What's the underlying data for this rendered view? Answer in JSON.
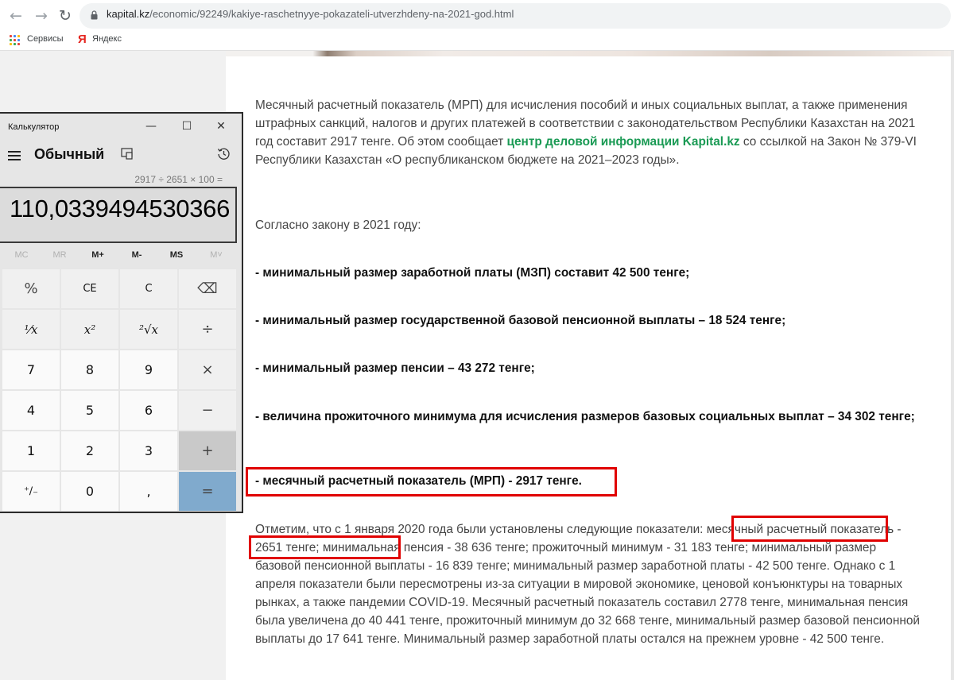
{
  "browser": {
    "url_host": "kapital.kz",
    "url_path": "/economic/92249/kakiye-raschetnyye-pokazateli-utverzhdeny-na-2021-god.html",
    "bookmarks": [
      "Сервисы",
      "Яндекс"
    ]
  },
  "calculator": {
    "title": "Калькулятор",
    "mode": "Обычный",
    "expression": "2917 ÷ 2651 × 100 =",
    "display": "110,0339494530366",
    "memory": [
      "MC",
      "MR",
      "M+",
      "M-",
      "MS",
      "M˅"
    ],
    "memory_enabled": [
      false,
      false,
      true,
      true,
      true,
      false
    ],
    "keys": [
      [
        "%",
        "CE",
        "C",
        "⌫"
      ],
      [
        "⅟x",
        "x²",
        "²√x",
        "÷"
      ],
      [
        "7",
        "8",
        "9",
        "×"
      ],
      [
        "4",
        "5",
        "6",
        "−"
      ],
      [
        "1",
        "2",
        "3",
        "+"
      ],
      [
        "⁺∕₋",
        "0",
        ",",
        "="
      ]
    ],
    "accent_equals": "#80aacd"
  },
  "article": {
    "intro_a": "Месячный расчетный показатель (МРП) для исчисления пособий и иных социальных выплат, а также применения штрафных санкций, налогов и других платежей в соответствии с законодательством Республики Казахстан на 2021 год составит 2917 тенге. Об этом сообщает ",
    "intro_link": "центр деловой информации Kapital.kz",
    "intro_b": " со ссылкой на Закон № 379-VI Республики Казахстан «О республиканском бюджете на 2021–2023 годы».",
    "lead": "Согласно закону в 2021 году:",
    "items": [
      "- минимальный размер заработной платы (МЗП) составит 42 500 тенге;",
      "- минимальный размер государственной базовой пенсионной выплаты – 18 524 тенге;",
      "- минимальный размер пенсии – 43 272 тенге;",
      "- величина прожиточного минимума для исчисления размеров базовых социальных выплат – 34 302 тенге;",
      "- месячный расчетный показатель (МРП) - 2917 тенге."
    ],
    "note": "Отметим, что с 1 января 2020 года были установлены следующие показатели: месячный расчетный показатель - 2651 тенге; минимальная пенсия - 38 636 тенге; прожиточный минимум - 31 183 тенге; минимальный размер базовой пенсионной выплаты - 16 839 тенге; минимальный размер заработной платы - 42 500 тенге. Однако с 1 апреля показатели были пересмотрены из-за ситуации в мировой экономике, ценовой конъюнктуры на товарных рынках, а также пандемии COVID-19. Месячный расчетный показатель составил 2778 тенге, минимальная пенсия была увеличена до  40 441 тенге, прожиточный минимум до 32 668 тенге, минимальный размер базовой пенсионной выплаты до 17 641 тенге. Минимальный размер заработной платы остался на прежнем уровне - 42 500 тенге.",
    "link_color": "#1a9a54",
    "highlight_color": "#e00000"
  }
}
